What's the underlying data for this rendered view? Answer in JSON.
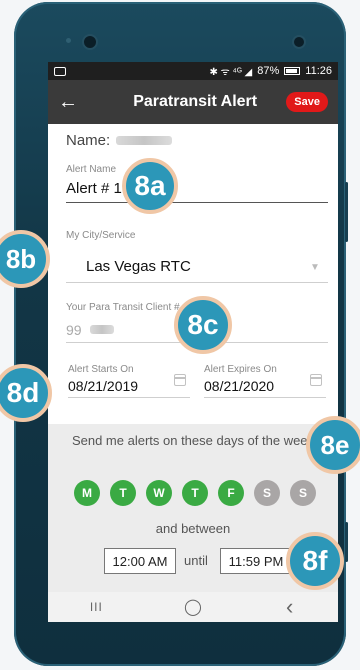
{
  "statusbar": {
    "icons": "✱ ᯤ ⁴ᴳ ◢",
    "battery": "87%",
    "time": "11:26"
  },
  "appbar": {
    "back_icon": "←",
    "title": "Paratransit Alert",
    "save_label": "Save"
  },
  "form": {
    "name_label": "Name:",
    "alert_name": {
      "label": "Alert Name",
      "value": "Alert # 1"
    },
    "city_service": {
      "label": "My City/Service",
      "value": "Las Vegas RTC"
    },
    "client_number": {
      "label": "Your Para Transit Client #",
      "value": "99"
    },
    "start_date": {
      "label": "Alert Starts On",
      "value": "08/21/2019"
    },
    "expire_date": {
      "label": "Alert Expires On",
      "value": "08/21/2020"
    }
  },
  "days": {
    "title": "Send me alerts on these days of the week",
    "items": [
      {
        "label": "M",
        "active": true
      },
      {
        "label": "T",
        "active": true
      },
      {
        "label": "W",
        "active": true
      },
      {
        "label": "T",
        "active": true
      },
      {
        "label": "F",
        "active": true
      },
      {
        "label": "S",
        "active": false
      },
      {
        "label": "S",
        "active": false
      }
    ],
    "between_label": "and between",
    "start_time": "12:00 AM",
    "until_label": "until",
    "end_time": "11:59 PM"
  },
  "navbar": {
    "recents": "III",
    "home": "◯",
    "back": "‹"
  },
  "badges": {
    "a": "8a",
    "b": "8b",
    "c": "8c",
    "d": "8d",
    "e": "8e",
    "f": "8f"
  },
  "colors": {
    "active_day": "#3aaa43",
    "inactive_day": "#a9a6a6",
    "badge": "#2c97b8",
    "badge_border": "#f0c7a6",
    "save": "#e11919"
  }
}
